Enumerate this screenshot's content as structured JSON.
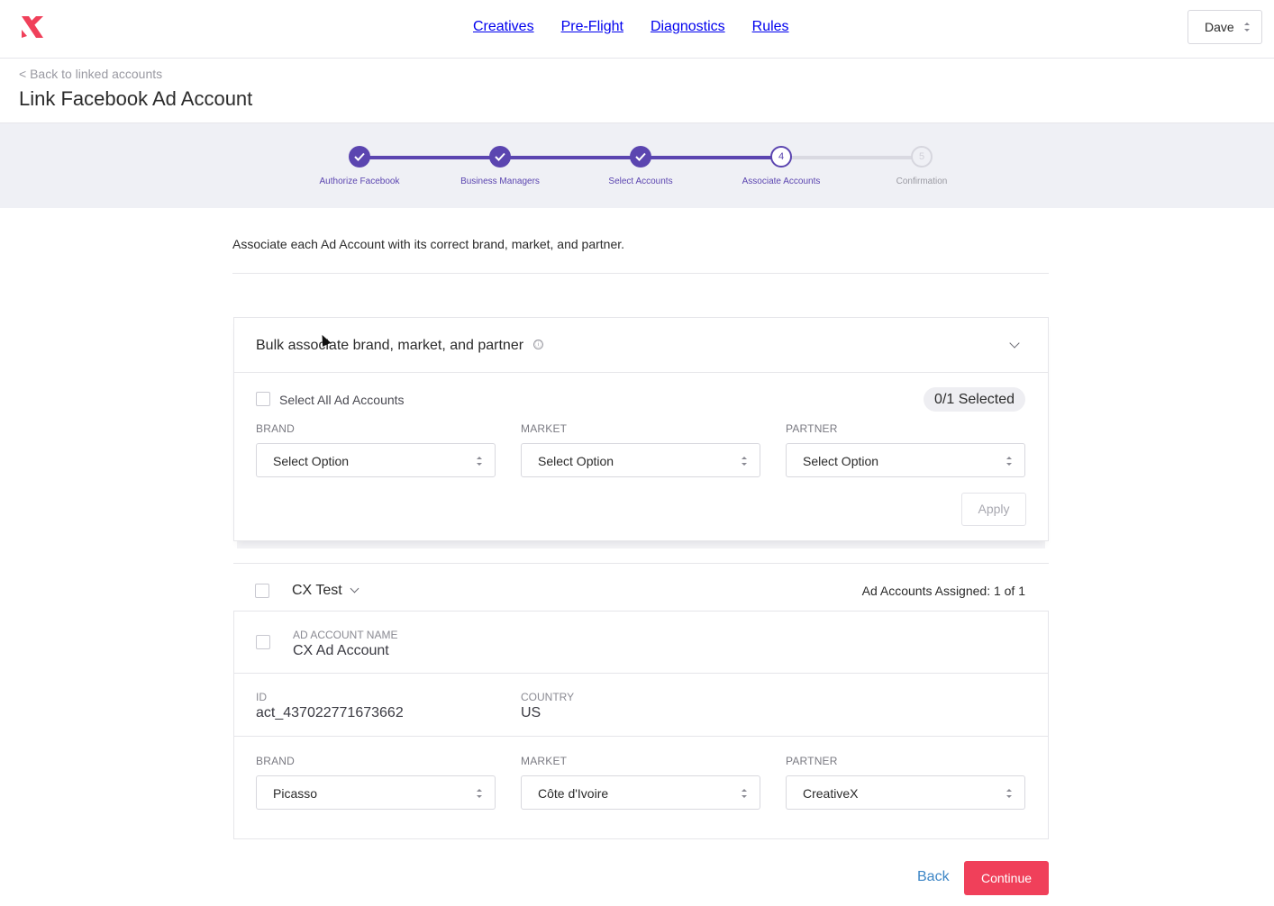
{
  "nav": {
    "items": [
      "Creatives",
      "Pre-Flight",
      "Diagnostics",
      "Rules"
    ],
    "user": "Dave",
    "brand_color": "#f0405a"
  },
  "header": {
    "back_link": "< Back to linked accounts",
    "title": "Link Facebook Ad Account"
  },
  "stepper": {
    "accent": "#5b45b0",
    "steps": [
      {
        "number": "1",
        "label": "Authorize Facebook",
        "status": "done"
      },
      {
        "number": "2",
        "label": "Business Managers",
        "status": "done"
      },
      {
        "number": "3",
        "label": "Select Accounts",
        "status": "done"
      },
      {
        "number": "4",
        "label": "Associate Accounts",
        "status": "current"
      },
      {
        "number": "5",
        "label": "Confirmation",
        "status": "future"
      }
    ]
  },
  "intro": "Associate each Ad Account with its correct brand, market, and partner.",
  "bulk": {
    "title": "Bulk associate brand, market, and partner",
    "info_icon": "ⓘ",
    "select_all_label": "Select All Ad Accounts",
    "selected_count": "0/1 Selected",
    "fields": [
      {
        "label": "BRAND",
        "value": "Select Option"
      },
      {
        "label": "MARKET",
        "value": "Select Option"
      },
      {
        "label": "PARTNER",
        "value": "Select Option"
      }
    ],
    "apply_label": "Apply"
  },
  "group": {
    "name": "CX Test",
    "assigned": "Ad Accounts Assigned: 1 of 1",
    "account": {
      "name_label": "AD ACCOUNT NAME",
      "name": "CX Ad Account",
      "id_label": "ID",
      "id": "act_437022771673662",
      "country_label": "COUNTRY",
      "country": "US",
      "fields": [
        {
          "label": "BRAND",
          "value": "Picasso"
        },
        {
          "label": "MARKET",
          "value": "Côte d'Ivoire"
        },
        {
          "label": "PARTNER",
          "value": "CreativeX"
        }
      ]
    }
  },
  "footer": {
    "back_label": "Back",
    "continue_label": "Continue"
  }
}
